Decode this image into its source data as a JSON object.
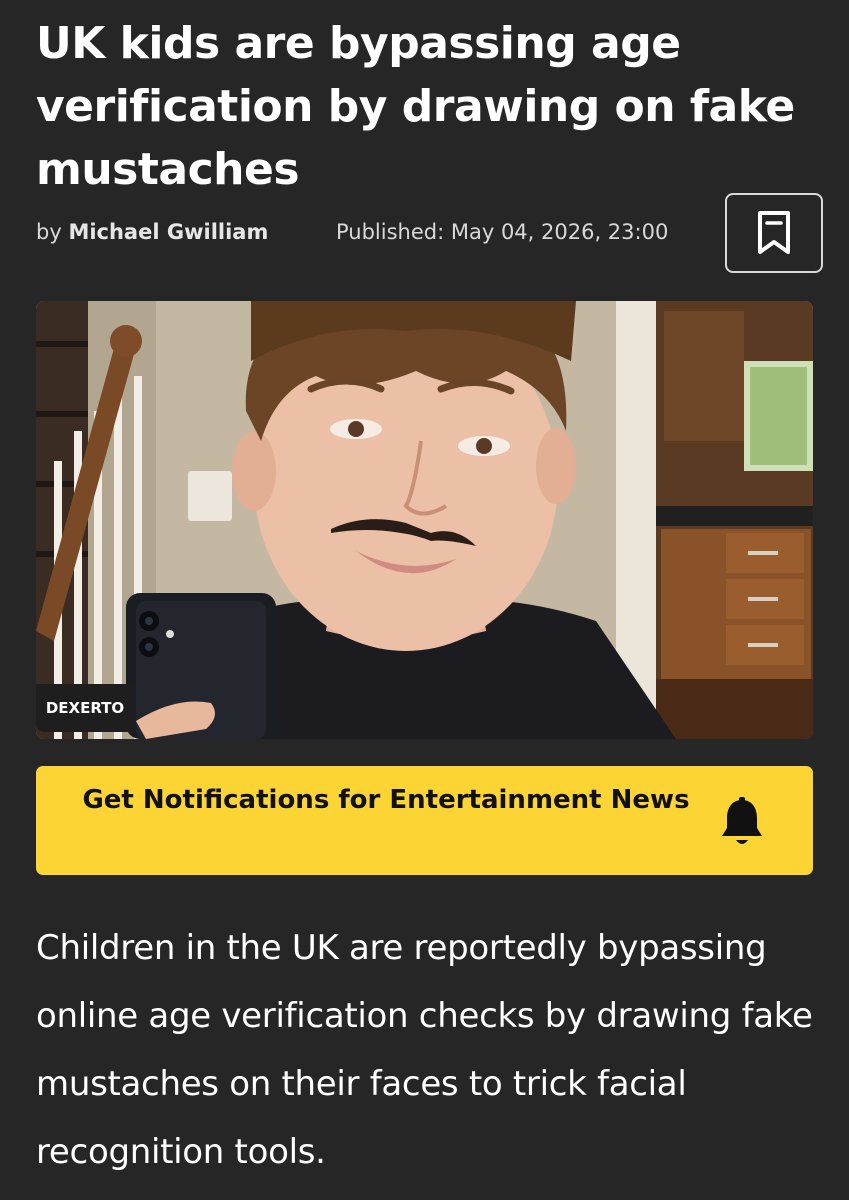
{
  "article": {
    "headline": "UK kids are bypassing age verification by drawing on fake mustaches",
    "byline_prefix": "by ",
    "author": "Michael Gwilliam",
    "published": "Published: May 04, 2026, 23:00",
    "bookmark_icon": "bookmark-icon",
    "image_credit": "DEXERTO",
    "notification_button": {
      "label": "Get Notifications for Entertainment News",
      "icon": "bell-icon"
    },
    "lede": "Children in the UK are reportedly bypassing online age verification checks by drawing fake mustaches on their faces to trick facial recognition tools."
  },
  "colors": {
    "background": "#262626",
    "text": "#ffffff",
    "accent": "#fcd535"
  }
}
